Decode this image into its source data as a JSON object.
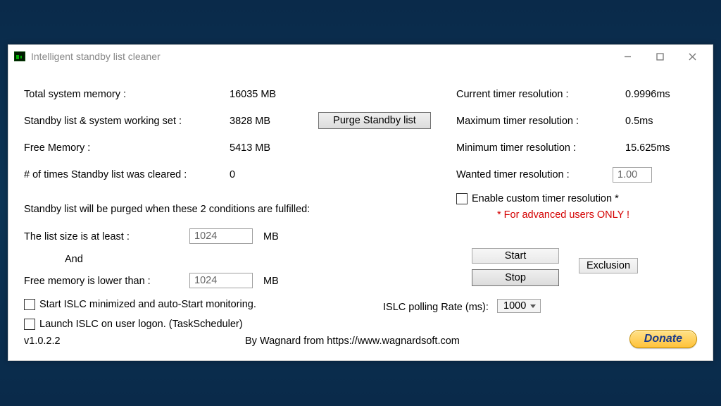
{
  "window": {
    "title": "Intelligent standby list cleaner"
  },
  "memory": {
    "total_label": "Total system memory :",
    "total_value": "16035 MB",
    "standby_label": "Standby list & system working set :",
    "standby_value": "3828 MB",
    "free_label": "Free Memory :",
    "free_value": "5413 MB",
    "cleared_label": "# of times Standby list was cleared :",
    "cleared_value": "0"
  },
  "purge_button": "Purge Standby list",
  "timer": {
    "current_label": "Current timer resolution :",
    "current_value": "0.9996ms",
    "max_label": "Maximum timer resolution :",
    "max_value": "0.5ms",
    "min_label": "Minimum timer resolution :",
    "min_value": "15.625ms",
    "wanted_label": "Wanted timer resolution :",
    "wanted_value": "1.00",
    "enable_label": "Enable custom timer resolution *",
    "warning": "* For advanced users ONLY !"
  },
  "conditions": {
    "heading": "Standby list will be purged when these 2 conditions are fulfilled:",
    "list_size_label": "The list size is at least :",
    "list_size_value": "1024",
    "unit": "MB",
    "and_label": "And",
    "free_mem_label": "Free memory is lower than :",
    "free_mem_value": "1024"
  },
  "options": {
    "autostart_label": "Start ISLC minimized and auto-Start monitoring.",
    "logon_label": "Launch ISLC on user logon. (TaskScheduler)"
  },
  "controls": {
    "start": "Start",
    "stop": "Stop",
    "exclusion": "Exclusion",
    "polling_label": "ISLC polling Rate (ms):",
    "polling_value": "1000"
  },
  "footer": {
    "version": "v1.0.2.2",
    "credit": "By Wagnard from https://www.wagnardsoft.com",
    "donate": "Donate"
  }
}
